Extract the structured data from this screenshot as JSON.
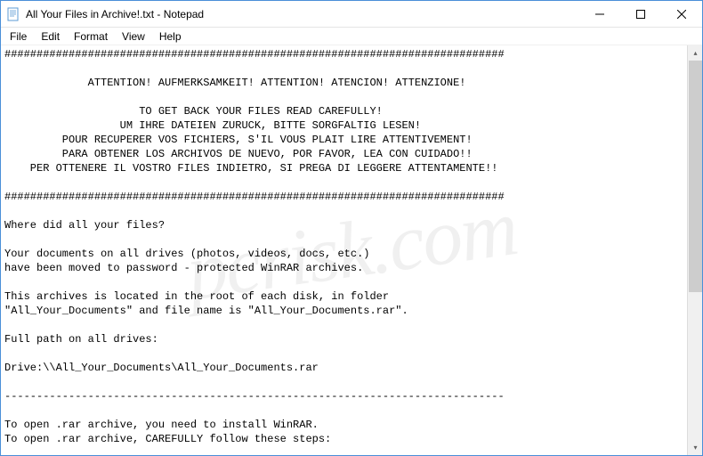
{
  "window": {
    "title": "All Your Files in Archive!.txt - Notepad"
  },
  "menu": {
    "file": "File",
    "edit": "Edit",
    "format": "Format",
    "view": "View",
    "help": "Help"
  },
  "content": {
    "text": "##############################################################################\n\n             ATTENTION! AUFMERKSAMKEIT! ATTENTION! ATENCION! ATTENZIONE!\n\n                     TO GET BACK YOUR FILES READ CAREFULLY!\n                  UM IHRE DATEIEN ZURUCK, BITTE SORGFALTIG LESEN!\n         POUR RECUPERER VOS FICHIERS, S'IL VOUS PLAIT LIRE ATTENTIVEMENT!\n         PARA OBTENER LOS ARCHIVOS DE NUEVO, POR FAVOR, LEA CON CUIDADO!!\n    PER OTTENERE IL VOSTRO FILES INDIETRO, SI PREGA DI LEGGERE ATTENTAMENTE!!\n\n##############################################################################\n\nWhere did all your files?\n\nYour documents on all drives (photos, videos, docs, etc.)\nhave been moved to password - protected WinRAR archives.\n\nThis archives is located in the root of each disk, in folder\n\"All_Your_Documents\" and file name is \"All_Your_Documents.rar\".\n\nFull path on all drives:\n\nDrive:\\\\All_Your_Documents\\All_Your_Documents.rar\n\n------------------------------------------------------------------------------\n\nTo open .rar archive, you need to install WinRAR.\nTo open .rar archive, CAREFULLY follow these steps:"
  },
  "watermark": "pcrisk.com"
}
